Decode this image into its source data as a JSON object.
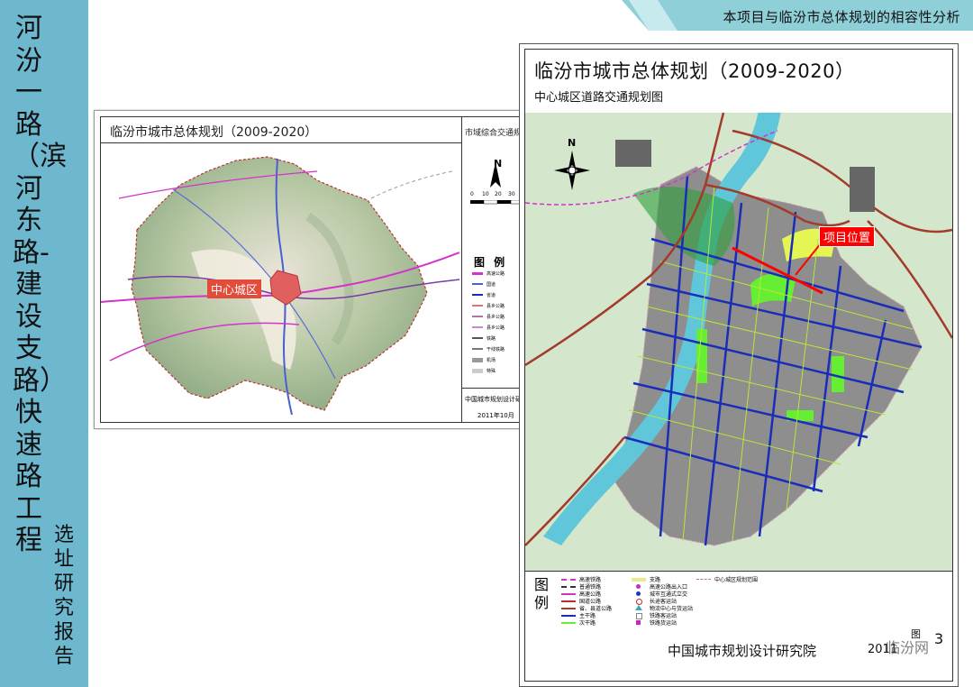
{
  "header": {
    "banner_text": "本项目与临汾市总体规划的相容性分析"
  },
  "sidebar": {
    "title": "河汾一路（滨河东路-建设支路）快速路工程",
    "subtitle": "选址研究报告"
  },
  "map_left": {
    "title": "临汾市城市总体规划（2009-2020）",
    "panel_title": "市域综合交通规划",
    "center_label": "中心城区",
    "legend_title": "图 例",
    "legend_items": [
      "高速公路",
      "国道",
      "省道",
      "县乡公路",
      "县乡公路",
      "县乡公路",
      "铁路",
      "干线铁路",
      "机场",
      "特殊"
    ],
    "institute": "中国城市规划设计研究院",
    "date": "2011年10月",
    "scale": [
      "0",
      "10",
      "20",
      "30"
    ],
    "north": "N"
  },
  "map_right": {
    "title": "临汾市城市总体规划（2009-2020）",
    "subtitle": "中心城区道路交通规划图",
    "project_label": "项目位置",
    "north": "N",
    "legend_title": "图例",
    "legend_col1": [
      "高速铁路",
      "普通铁路",
      "高速公路",
      "国道公路",
      "省、县道公路",
      "主干路",
      "次干路"
    ],
    "legend_col2": [
      "支路",
      "高速公路出入口",
      "城市互通式立交",
      "长途客运站",
      "物流中心与货运站",
      "铁路客运站",
      "铁路货运站"
    ],
    "legend_col3": [
      "中心城区规划范围"
    ],
    "institute": "中国城市规划设计研究院",
    "date_partial": "2011",
    "sheet": "图",
    "sheet_num": "3",
    "watermark": "临汾网"
  },
  "colors": {
    "sidebar": "#6db7cf",
    "banner": "#8fcfd8",
    "urban": "#8e8e8e",
    "river": "#5fc7d9",
    "green": "#66ee33",
    "trunk_road": "#1a2db8",
    "highway": "#c22a2a",
    "project": "#ff0000"
  }
}
